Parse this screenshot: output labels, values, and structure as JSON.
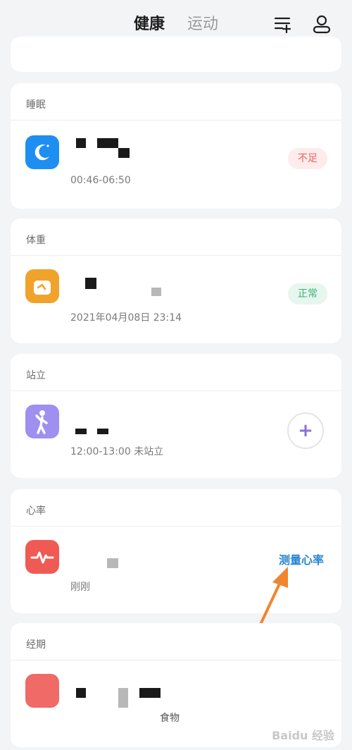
{
  "header": {
    "tabs": [
      {
        "label": "健康",
        "active": true
      },
      {
        "label": "运动",
        "active": false
      }
    ],
    "icons": [
      "filter-add-icon",
      "user-icon"
    ]
  },
  "cards": {
    "sleep": {
      "title": "睡眠",
      "subtitle": "00:46-06:50",
      "badge": "不足",
      "icon": "moon-icon",
      "color": "#1e8ff0"
    },
    "weight": {
      "title": "体重",
      "subtitle": "2021年04月08日 23:14",
      "badge": "正常",
      "icon": "scale-icon",
      "color": "#f0a32a"
    },
    "standing": {
      "title": "站立",
      "subtitle": "12:00-13:00 未站立",
      "action": "+",
      "icon": "standing-person-icon",
      "color": "#9f8ff0"
    },
    "heart": {
      "title": "心率",
      "subtitle": "刚刚",
      "action": "测量心率",
      "icon": "heartbeat-icon",
      "color": "#f05a55"
    },
    "period": {
      "title": "经期",
      "subtitle": "食物",
      "icon": "period-icon",
      "color": "#f06a66"
    }
  },
  "watermark": "Baidu 经验"
}
